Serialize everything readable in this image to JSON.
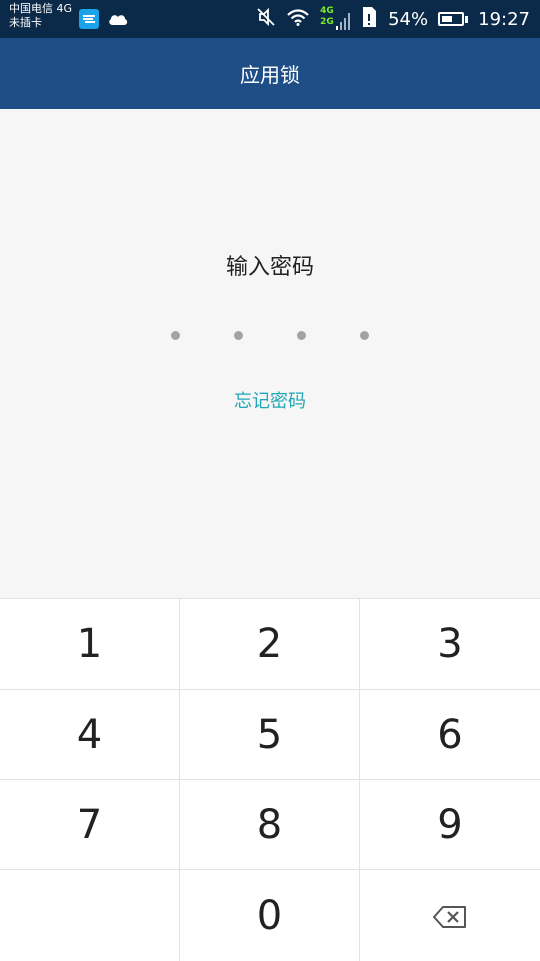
{
  "status_bar": {
    "carrier_line1": "中国电信 4G",
    "carrier_line2": "未插卡",
    "network_top": "4G",
    "network_bottom": "2G",
    "battery_percent_text": "54%",
    "battery_level": 0.54,
    "time": "19:27",
    "icons": [
      "app-notification-icon",
      "cloud-icon",
      "vibrate-mute-icon",
      "wifi-icon",
      "signal-icon",
      "sim-icon",
      "battery-icon"
    ]
  },
  "header": {
    "title": "应用锁"
  },
  "lock": {
    "prompt": "输入密码",
    "dot_count": 4,
    "forgot_label": "忘记密码"
  },
  "keypad": {
    "keys": [
      "1",
      "2",
      "3",
      "4",
      "5",
      "6",
      "7",
      "8",
      "9",
      "",
      "0",
      "backspace"
    ]
  },
  "colors": {
    "header_bg": "#1f4e87",
    "status_bg": "#0b2a4a",
    "accent": "#1fa7b7",
    "dot": "#a3a3a3"
  }
}
